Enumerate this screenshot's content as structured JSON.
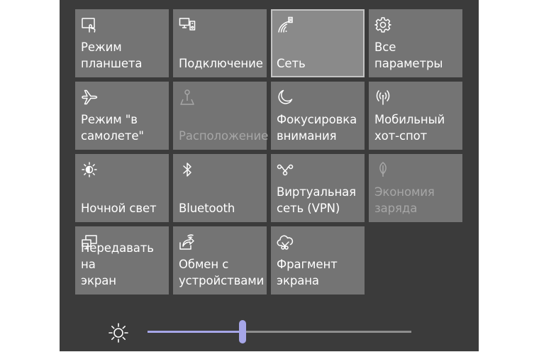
{
  "quick_actions": [
    {
      "id": "tablet-mode",
      "label": "Режим\nпланшета",
      "icon": "tablet-mode-icon",
      "state": "normal"
    },
    {
      "id": "connect",
      "label": "Подключение",
      "icon": "connect-icon",
      "state": "normal"
    },
    {
      "id": "network",
      "label": "Сеть",
      "icon": "network-icon",
      "state": "active"
    },
    {
      "id": "all-settings",
      "label": "Все\nпараметры",
      "icon": "gear-icon",
      "state": "normal"
    },
    {
      "id": "airplane-mode",
      "label": "Режим \"в\nсамолете\"",
      "icon": "airplane-icon",
      "state": "normal"
    },
    {
      "id": "location",
      "label": "Расположение",
      "icon": "location-icon",
      "state": "disabled"
    },
    {
      "id": "focus-assist",
      "label": "Фокусировка\nвнимания",
      "icon": "moon-icon",
      "state": "normal"
    },
    {
      "id": "mobile-hotspot",
      "label": "Мобильный\nхот-спот",
      "icon": "hotspot-icon",
      "state": "normal"
    },
    {
      "id": "night-light",
      "label": "Ночной свет",
      "icon": "night-light-icon",
      "state": "normal"
    },
    {
      "id": "bluetooth",
      "label": "Bluetooth",
      "icon": "bluetooth-icon",
      "state": "normal"
    },
    {
      "id": "vpn",
      "label": "Виртуальная\nсеть (VPN)",
      "icon": "vpn-icon",
      "state": "normal"
    },
    {
      "id": "battery-saver",
      "label": "Экономия\nзаряда",
      "icon": "leaf-icon",
      "state": "disabled"
    },
    {
      "id": "project",
      "label": "Передавать на\nэкран",
      "icon": "project-icon",
      "state": "normal"
    },
    {
      "id": "nearby-sharing",
      "label": "Обмен с\nустройствами",
      "icon": "share-icon",
      "state": "normal"
    },
    {
      "id": "screen-snip",
      "label": "Фрагмент\nэкрана",
      "icon": "snip-icon",
      "state": "normal"
    }
  ],
  "brightness": {
    "icon": "brightness-sun-icon",
    "level_percent": 36
  },
  "colors": {
    "panel_background": "#3b3b3b",
    "tile_background": "#747474",
    "tile_active_background": "#8a8a8a",
    "accent": "#a6a6e8",
    "disabled_text": "#a6a6a6"
  }
}
